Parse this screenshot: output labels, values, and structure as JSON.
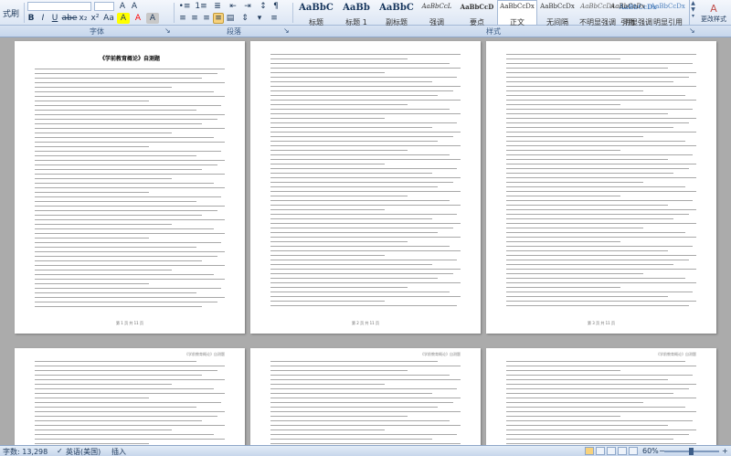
{
  "ribbon": {
    "clipboard_partial": "式刷",
    "font_buttons": [
      "B",
      "I",
      "U",
      "abe",
      "x₂",
      "x²",
      "Aa",
      "A",
      "A",
      "A"
    ],
    "para_buttons": [
      "≡",
      "≡",
      "≡",
      "≡",
      "▤",
      "⇕",
      "▾",
      "¶",
      "≡",
      "≡"
    ],
    "styles": [
      {
        "preview": "AaBbC",
        "name": "标题"
      },
      {
        "preview": "AaBb",
        "name": "标题 1"
      },
      {
        "preview": "AaBbC",
        "name": "副标题"
      },
      {
        "preview": "AaBbCcL",
        "name": "强调"
      },
      {
        "preview": "AaBbCcD",
        "name": "要点"
      },
      {
        "preview": "AaBbCcDx",
        "name": "正文"
      },
      {
        "preview": "AaBbCcDx",
        "name": "无间隔"
      },
      {
        "preview": "AaBbCcDx",
        "name": "不明显强调"
      },
      {
        "preview": "AaBbCcDx",
        "name": "明显强调"
      },
      {
        "preview": "AaBbCcDx",
        "name": "引用"
      },
      {
        "preview": "AaBbCcDx",
        "name": "明显引用"
      }
    ],
    "change_styles": "更改样式"
  },
  "group_labels": {
    "font": "字体",
    "paragraph": "段落",
    "styles": "样式"
  },
  "colors": {
    "highlight": "#FFFF00",
    "font_color": "#FF0000",
    "accent": "#1E395B"
  },
  "pages": [
    {
      "title": "《学前教育概论》自测题",
      "header": "",
      "footer": "第 1 页 共 11 页"
    },
    {
      "title": "",
      "header": "",
      "footer": "第 2 页 共 11 页"
    },
    {
      "title": "",
      "header": "",
      "footer": "第 3 页 共 11 页"
    },
    {
      "title": "",
      "header": "《学前教育概论》自测题",
      "footer": ""
    },
    {
      "title": "",
      "header": "《学前教育概论》自测题",
      "footer": ""
    },
    {
      "title": "",
      "header": "《学前教育概论》自测题",
      "footer": ""
    }
  ],
  "status": {
    "word_count": "字数: 13,298",
    "language": "英语(美国)",
    "insert_mode": "插入",
    "zoom": "60%"
  }
}
